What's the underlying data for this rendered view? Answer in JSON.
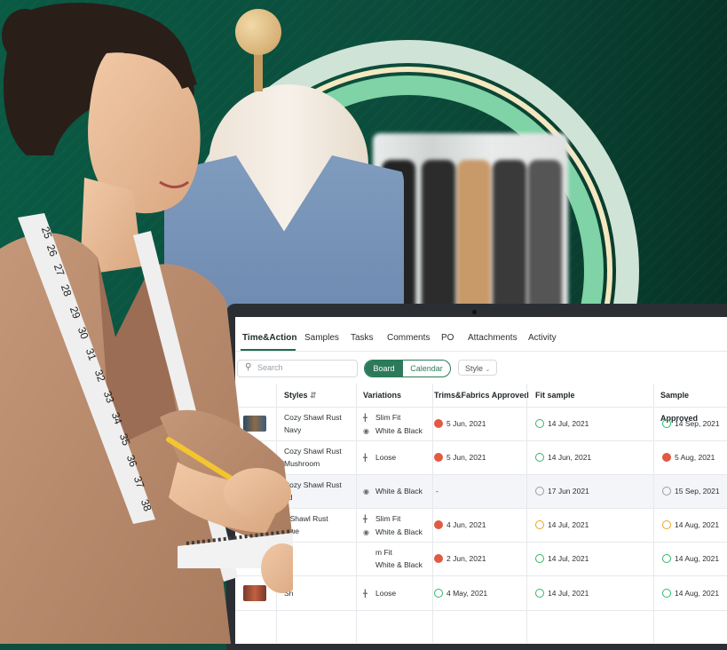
{
  "tabs": [
    "Time&Action",
    "Samples",
    "Tasks",
    "Comments",
    "PO",
    "Attachments",
    "Activity"
  ],
  "active_tab": "Time&Action",
  "toolbar": {
    "search_placeholder": "Search",
    "view_board": "Board",
    "view_calendar": "Calendar",
    "style_filter": "Style"
  },
  "table": {
    "headers": {
      "styles": "Styles",
      "variations": "Variations",
      "trims": "Trims&Fabrics Approved",
      "fit": "Fit sample",
      "sample": "Sample Approved"
    },
    "rows": [
      {
        "style": "Cozy Shawl Rust",
        "style2": "Navy",
        "var1": "Slim Fit",
        "var2": "White & Black",
        "trims": "5 Jun, 2021",
        "fit": "14 Jul, 2021",
        "sample": "14 Sep, 2021",
        "trims_status": "err",
        "fit_status": "ok",
        "sample_status": "ok"
      },
      {
        "style": "Cozy Shawl Rust",
        "style2": "Mushroom",
        "var1": "Loose",
        "var2": "",
        "trims": "5 Jun, 2021",
        "fit": "14 Jun, 2021",
        "sample": "5 Aug, 2021",
        "trims_status": "err",
        "fit_status": "ok",
        "sample_status": "err"
      },
      {
        "style": "Cozy Shawl Rust",
        "style2": "ed",
        "var1": "White & Black",
        "var2": "",
        "trims": "-",
        "fit": "17 Jun 2021",
        "sample": "15 Sep, 2021",
        "trims_status": "",
        "fit_status": "clock",
        "sample_status": "clock"
      },
      {
        "style": "y Shawl Rust",
        "style2": "Blue",
        "var1": "Slim Fit",
        "var2": "White & Black",
        "trims": "4 Jun, 2021",
        "fit": "14 Jul, 2021",
        "sample": "14 Aug, 2021",
        "trims_status": "err",
        "fit_status": "warn",
        "sample_status": "warn"
      },
      {
        "style": "",
        "style2": "",
        "var1": "m Fit",
        "var2": "White & Black",
        "trims": "2 Jun, 2021",
        "fit": "14 Jul, 2021",
        "sample": "14 Aug, 2021",
        "trims_status": "err",
        "fit_status": "ok",
        "sample_status": "ok"
      },
      {
        "style": "Sh",
        "style2": "",
        "var1": "Loose",
        "var2": "",
        "trims": "4 May, 2021",
        "fit": "14 Jul, 2021",
        "sample": "14 Aug, 2021",
        "trims_status": "ok",
        "fit_status": "ok",
        "sample_status": "ok"
      }
    ]
  },
  "tape_numbers": [
    "25",
    "26",
    "27",
    "28",
    "29",
    "30",
    "31",
    "32",
    "33",
    "34",
    "35",
    "36",
    "37",
    "38"
  ],
  "colors": {
    "brand": "#2c7a5a",
    "ok": "#2fb66a",
    "warn": "#f0a020",
    "error": "#e05a44"
  }
}
